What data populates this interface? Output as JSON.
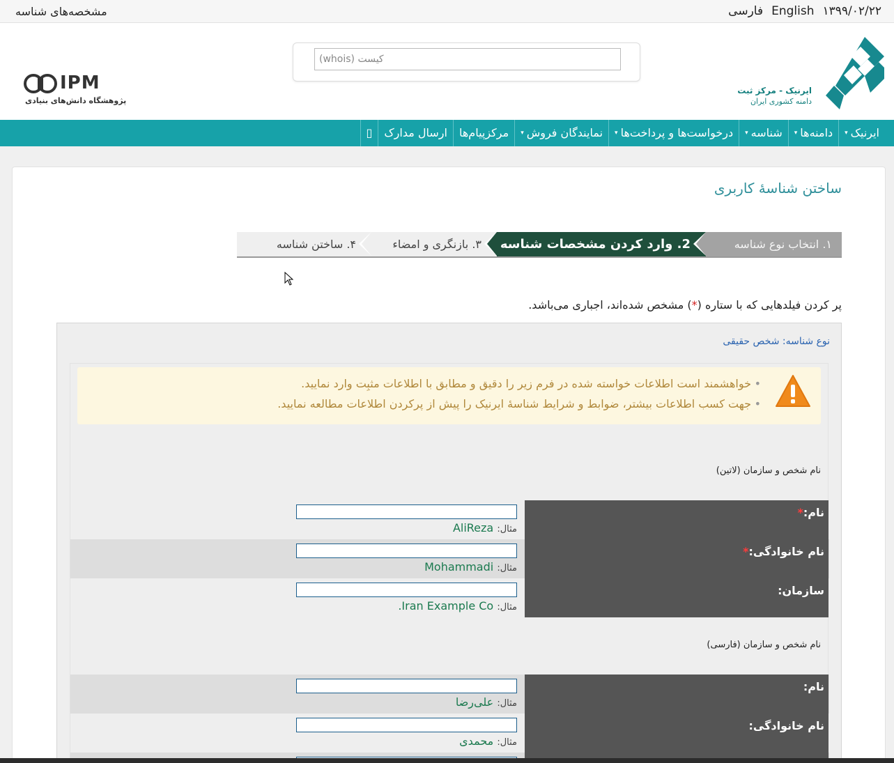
{
  "topbar": {
    "date": "۱۳۹۹/۰۲/۲۲",
    "lang_en": "English",
    "lang_fa": "فارسی",
    "page_link": "مشخصه‌های شناسه"
  },
  "search": {
    "placeholder": "کیست (whois)"
  },
  "logo_irnic": {
    "name_line1": "ایرنیک - مرکز ثبت",
    "name_line2": "دامنه کشوری ایران"
  },
  "logo_ipm": {
    "text": "IPM",
    "subtitle": "پژوهشگاه دانش‌های بنیادی"
  },
  "nav": {
    "items": [
      {
        "label": "ایرنیک",
        "caret": "▾"
      },
      {
        "label": "دامنه‌ها",
        "caret": "▾"
      },
      {
        "label": "شناسه",
        "caret": "▾"
      },
      {
        "label": "درخواست‌ها و پرداخت‌ها",
        "caret": "▾"
      },
      {
        "label": "نمایندگان فروش",
        "caret": "▾"
      },
      {
        "label": "مرکزپیام‌ها",
        "caret": ""
      },
      {
        "label": "ارسال مدارک",
        "caret": ""
      }
    ],
    "icon_box": "▯"
  },
  "page": {
    "title": "ساختن شناسهٔ کاربری",
    "steps": [
      "۱.  انتخاب نوع شناسه",
      "2.  وارد کردن مشخصات شناسه",
      "۳.  بازنگری و امضاء",
      "۴.  ساختن شناسه"
    ],
    "required_note_pre": "پر کردن فیلدهایی که با ستاره (",
    "required_star": "*",
    "required_note_post": ") مشخص شده‌اند، اجباری می‌باشد."
  },
  "form": {
    "id_type": "نوع شناسه: شخص حقیقی",
    "warnings": [
      "خواهشمند است اطلاعات خواسته شده در فرم زیر را دقیق و مطابق با اطلاعات مثبِت وارد نمایید.",
      "جهت کسب اطلاعات بیشتر، ضوابط و شرایط شناسهٔ ایرنیک را پیش از پرکردن اطلاعات مطالعه نمایید."
    ],
    "example_key": "مثال:",
    "section_latin": "نام شخص و سازمان (لاتین)",
    "section_farsi": "نام شخص و سازمان (فارسی)",
    "latin_rows": [
      {
        "label": "نام:",
        "required": "*",
        "example": "AliReza"
      },
      {
        "label": "نام خانوادگی:",
        "required": "*",
        "example": "Mohammadi"
      },
      {
        "label": "سازمان:",
        "required": "",
        "example": "Iran Example Co."
      }
    ],
    "farsi_rows": [
      {
        "label": "نام:",
        "required": "",
        "example": "علی‌رضا"
      },
      {
        "label": "نام خانوادگی:",
        "required": "",
        "example": "محمدی"
      },
      {
        "label": "",
        "required": "",
        "example": ""
      }
    ]
  },
  "colors": {
    "nav_bg": "#17a2a9",
    "active_step": "#1f4f3c",
    "title": "#2f8f9a",
    "warning_bg": "#fdf7e0",
    "warning_text": "#b0883b",
    "label_bg": "#555555",
    "example_text": "#1b7a4f"
  }
}
